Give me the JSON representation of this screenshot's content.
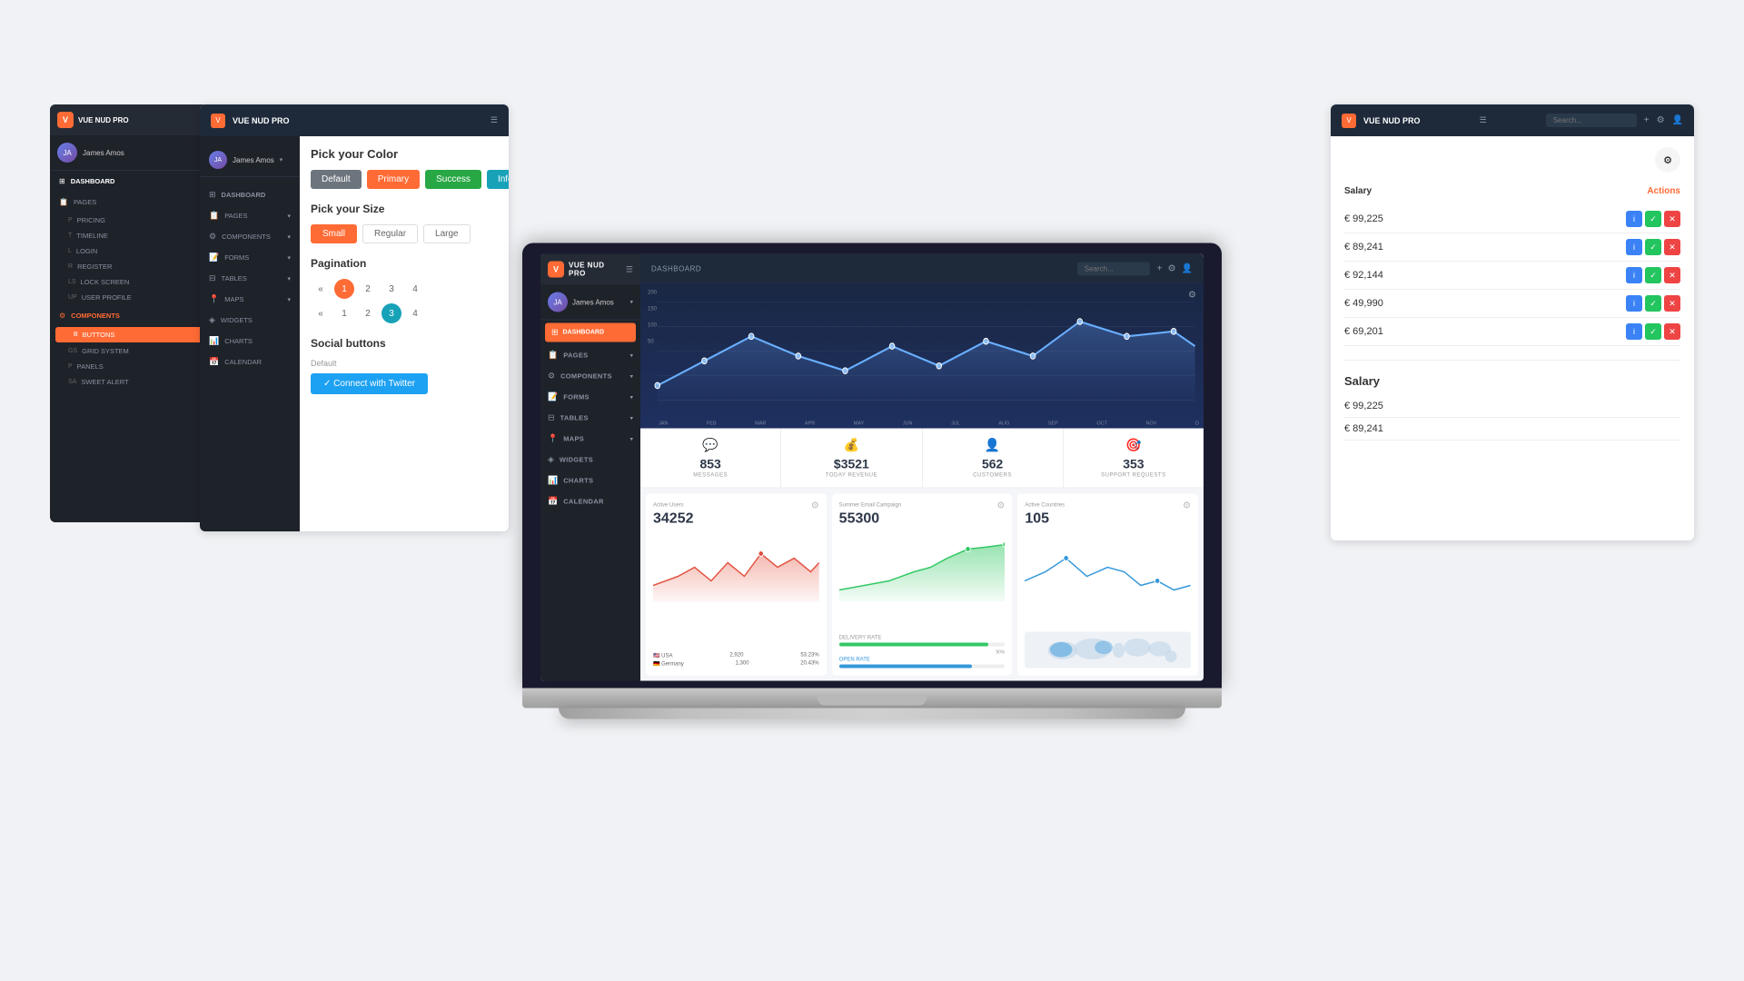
{
  "brand": {
    "name": "VUE NUD PRO",
    "logo_icon": "V"
  },
  "sidebar": {
    "user": "James Amos",
    "nav_items": [
      {
        "label": "DASHBOARD",
        "icon": "⊞",
        "active": false
      },
      {
        "label": "PAGES",
        "icon": "📄",
        "active": false
      },
      {
        "label": "COMPONENTS",
        "icon": "⚙",
        "active": true
      }
    ],
    "sub_items": [
      {
        "label": "PRICING",
        "prefix": "P"
      },
      {
        "label": "TIMELINE",
        "prefix": "T"
      },
      {
        "label": "LOGIN",
        "prefix": "L"
      },
      {
        "label": "REGISTER",
        "prefix": "R"
      },
      {
        "label": "LOCK SCREEN",
        "prefix": "LS"
      },
      {
        "label": "USER PROFILE",
        "prefix": "UP"
      }
    ],
    "components_items": [
      {
        "label": "BUTTONS",
        "prefix": "B",
        "active": true
      },
      {
        "label": "GRID SYSTEM",
        "prefix": "GS"
      },
      {
        "label": "PANELS",
        "prefix": "P"
      },
      {
        "label": "SWEET ALERT",
        "prefix": "SA"
      }
    ]
  },
  "color_picker": {
    "title": "Pick your Color",
    "swatches": [
      "Default",
      "Primary",
      "Success",
      "Info"
    ],
    "size_title": "Pick your Size",
    "sizes": [
      "Small",
      "Regular",
      "Large"
    ],
    "pagination_title": "Pagination",
    "pages1": [
      "«",
      "1",
      "2",
      "3",
      "4"
    ],
    "pages2": [
      "«",
      "1",
      "2",
      "3",
      "4"
    ],
    "social_title": "Social buttons",
    "default_label": "Default",
    "twitter_btn": "✓ Connect with Twitter"
  },
  "dashboard": {
    "page_title": "DASHBOARD",
    "search_placeholder": "Search...",
    "chart": {
      "y_labels": [
        "200",
        "150",
        "100",
        "50"
      ],
      "x_labels": [
        "JAN",
        "FEB",
        "MAR",
        "APR",
        "MAY",
        "JUN",
        "JUL",
        "AUG",
        "SEP",
        "OCT",
        "NOV",
        "D"
      ]
    },
    "stats": [
      {
        "value": "853",
        "label": "MESSAGES",
        "icon": "💬",
        "color": "#e74c3c"
      },
      {
        "value": "$3521",
        "label": "TODAY REVENUE",
        "icon": "💰",
        "color": "#27ae60"
      },
      {
        "value": "562",
        "label": "CUSTOMERS",
        "icon": "👤",
        "color": "#3498db"
      },
      {
        "value": "353",
        "label": "SUPPORT REQUESTS",
        "icon": "🎯",
        "color": "#e74c3c"
      }
    ],
    "widgets": [
      {
        "label": "Active Users",
        "value": "34252",
        "footer": [
          {
            "country": "🇺🇸 USA",
            "val1": "2,920",
            "val2": "53.23%"
          },
          {
            "country": "🇩🇪 Germany",
            "val1": "1,300",
            "val2": "20.43%"
          }
        ]
      },
      {
        "label": "Summer Email Campaign",
        "value": "55300",
        "footer": [
          {
            "label": "DELIVERY RATE",
            "val": "90%"
          },
          {
            "label": "OPEN RATE",
            "val": "80%"
          }
        ]
      },
      {
        "label": "Active Countries",
        "value": "105"
      }
    ]
  },
  "right_panel": {
    "salary_header": "Salary",
    "actions_header": "Actions",
    "rows": [
      {
        "salary": "€ 99,225"
      },
      {
        "salary": "€ 89,241"
      },
      {
        "salary": "€ 92,144"
      },
      {
        "salary": "€ 49,990"
      },
      {
        "salary": "€ 69,201"
      }
    ],
    "salary_header2": "Salary",
    "rows2": [
      {
        "salary": "€ 99,225"
      },
      {
        "salary": "€ 89,241"
      }
    ]
  }
}
